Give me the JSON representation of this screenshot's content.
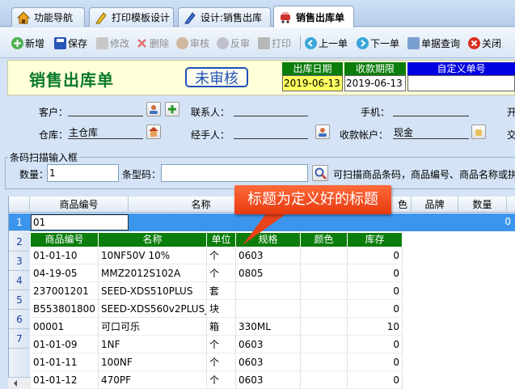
{
  "tabs": [
    {
      "label": "功能导航",
      "icon": "home-icon"
    },
    {
      "label": "打印模板设计",
      "icon": "pencil-icon"
    },
    {
      "label": "设计:销售出库",
      "icon": "pencil-blue-icon"
    },
    {
      "label": "销售出库单",
      "icon": "cart-icon",
      "active": true
    }
  ],
  "toolbar": {
    "new_label": "新增",
    "save_label": "保存",
    "edit_label": "修改",
    "delete_label": "删除",
    "approve_label": "审核",
    "unapprove_label": "反审",
    "print_label": "打印",
    "prev_label": "上一单",
    "next_label": "下一单",
    "query_label": "单据查询",
    "close_label": "关闭"
  },
  "header": {
    "title": "销售出库单",
    "status_stamp": "未审核",
    "outbound_date_label": "出库日期",
    "outbound_date": "2019-06-13",
    "payment_due_label": "收款期限",
    "payment_due": "2019-06-13",
    "custom_no_label": "自定义单号",
    "custom_no": ""
  },
  "form": {
    "customer_label": "客户：",
    "customer": "",
    "contact_label": "联系人：",
    "contact": "",
    "phone_label": "手机：",
    "phone": "",
    "cut_label_1": "开",
    "warehouse_label": "仓库：",
    "warehouse": "主仓库",
    "handler_label": "经手人：",
    "handler": "",
    "account_label": "收款帐户：",
    "account": "现金",
    "cut_label_2": "交"
  },
  "scan": {
    "legend": "条码扫描输入框",
    "qty_label": "数量：",
    "qty": "1",
    "barcode_label": "条型码：",
    "barcode": "",
    "hint": "可扫描商品条码，商品编号、商品名称或拼"
  },
  "grid": {
    "columns": [
      "商品编号",
      "名称",
      "色",
      "品牌",
      "数量"
    ],
    "row_numbers": [
      "1",
      "2",
      "3",
      "4",
      "5",
      "6",
      "7"
    ],
    "edit_value": "01",
    "row1_qty": "0"
  },
  "dropdown": {
    "columns": [
      "商品编号",
      "名称",
      "单位",
      "规格",
      "颜色",
      "库存"
    ],
    "rows": [
      {
        "code": "01-01-10",
        "name": "10NF50V 10%",
        "unit": "个",
        "spec": "0603",
        "color": "",
        "stock": "0"
      },
      {
        "code": "04-19-05",
        "name": "MMZ2012S102A",
        "unit": "个",
        "spec": "0805",
        "color": "",
        "stock": "0"
      },
      {
        "code": "237001201",
        "name": "SEED-XDS510PLUS",
        "unit": "套",
        "spec": "",
        "color": "",
        "stock": "0"
      },
      {
        "code": "B553801800",
        "name": "SEED-XDS560v2PLUS_",
        "unit": "块",
        "spec": "",
        "color": "",
        "stock": "0"
      },
      {
        "code": "00001",
        "name": "可口可乐",
        "unit": "箱",
        "spec": "330ML",
        "color": "",
        "stock": "10"
      },
      {
        "code": "01-01-09",
        "name": "1NF",
        "unit": "个",
        "spec": "0603",
        "color": "",
        "stock": "0"
      },
      {
        "code": "01-01-11",
        "name": "100NF",
        "unit": "个",
        "spec": "0603",
        "color": "",
        "stock": "0"
      },
      {
        "code": "01-01-12",
        "name": "470PF",
        "unit": "个",
        "spec": "0603",
        "color": "",
        "stock": "0"
      }
    ]
  },
  "callout": {
    "text": "标题为定义好的标题"
  },
  "colors": {
    "title_green": "#0a7a2a",
    "grid_header_green": "#0b7d0b",
    "selected_row": "#3c95ec",
    "callout": "#f04a1c"
  }
}
